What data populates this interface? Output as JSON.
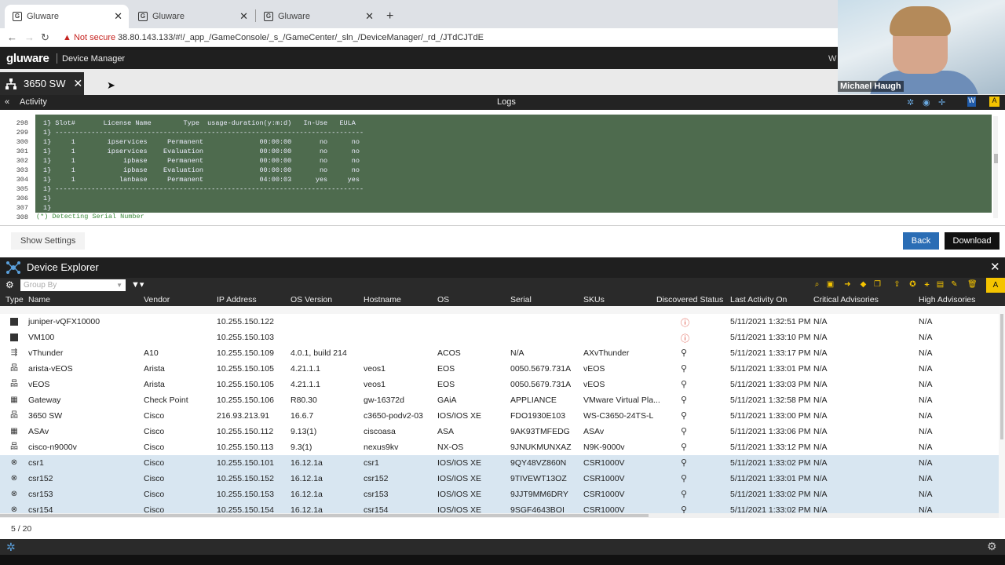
{
  "browser": {
    "tabs": [
      {
        "label": "Gluware",
        "active": true
      },
      {
        "label": "Gluware",
        "active": false
      },
      {
        "label": "Gluware",
        "active": false
      }
    ],
    "security_label": "Not secure",
    "url": "38.80.143.133/#!/_app_/GameConsole/_s_/GameCenter/_sln_/DeviceManager/_rd_/JTdCJTdE"
  },
  "app": {
    "logo": "gluware",
    "title": "Device Manager",
    "header_overflow": "W"
  },
  "device_tab": {
    "label": "3650 SW"
  },
  "activity_bar": {
    "left_label": "Activity",
    "center_label": "Logs"
  },
  "logs": {
    "line_numbers": [
      "298",
      "299",
      "300",
      "301",
      "302",
      "303",
      "304",
      "305",
      "306",
      "307",
      "308"
    ],
    "lines": [
      "1} Slot#       License Name        Type  usage-duration(y:m:d)   In-Use   EULA",
      "1} -----------------------------------------------------------------------------",
      "1}     1        ipservices     Permanent              00:00:00       no      no",
      "1}     1        ipservices    Evaluation              00:00:00       no      no",
      "1}     1            ipbase     Permanent              00:00:00       no      no",
      "1}     1            ipbase    Evaluation              00:00:00       no      no",
      "1}     1           lanbase     Permanent              04:00:03      yes     yes",
      "1} -----------------------------------------------------------------------------",
      "1}",
      "1}"
    ],
    "detecting": "(*) Detecting Serial Number"
  },
  "settings": {
    "show_settings": "Show Settings",
    "back": "Back",
    "download": "Download"
  },
  "explorer": {
    "title": "Device Explorer",
    "group_by_placeholder": "Group By",
    "columns": [
      "Type",
      "Name",
      "Vendor",
      "IP Address",
      "OS Version",
      "Hostname",
      "OS",
      "Serial",
      "SKUs",
      "Discovered Status",
      "Last Activity On",
      "Critical Advisories",
      "High Advisories"
    ],
    "rows": [
      {
        "type": "square",
        "name": "juniper-vQFX10000",
        "vendor": "",
        "ip": "10.255.150.122",
        "os_version": "",
        "hostname": "",
        "os": "",
        "serial": "",
        "skus": "",
        "status": "warn",
        "last": "5/11/2021 1:32:51 PM",
        "critical": "N/A",
        "high": "N/A",
        "selected": false
      },
      {
        "type": "square",
        "name": "VM100",
        "vendor": "",
        "ip": "10.255.150.103",
        "os_version": "",
        "hostname": "",
        "os": "",
        "serial": "",
        "skus": "",
        "status": "warn",
        "last": "5/11/2021 1:33:10 PM",
        "critical": "N/A",
        "high": "N/A",
        "selected": false
      },
      {
        "type": "loadbalancer",
        "name": "vThunder",
        "vendor": "A10",
        "ip": "10.255.150.109",
        "os_version": "4.0.1, build 214",
        "hostname": "",
        "os": "ACOS",
        "serial": "N/A",
        "skus": "AXvThunder",
        "status": "ok",
        "last": "5/11/2021 1:33:17 PM",
        "critical": "N/A",
        "high": "N/A",
        "selected": false
      },
      {
        "type": "switch",
        "name": "arista-vEOS",
        "vendor": "Arista",
        "ip": "10.255.150.105",
        "os_version": "4.21.1.1",
        "hostname": "veos1",
        "os": "EOS",
        "serial": "0050.5679.731A",
        "skus": "vEOS",
        "status": "ok",
        "last": "5/11/2021 1:33:01 PM",
        "critical": "N/A",
        "high": "N/A",
        "selected": false
      },
      {
        "type": "switch",
        "name": "vEOS",
        "vendor": "Arista",
        "ip": "10.255.150.105",
        "os_version": "4.21.1.1",
        "hostname": "veos1",
        "os": "EOS",
        "serial": "0050.5679.731A",
        "skus": "vEOS",
        "status": "ok",
        "last": "5/11/2021 1:33:03 PM",
        "critical": "N/A",
        "high": "N/A",
        "selected": false
      },
      {
        "type": "firewall",
        "name": "Gateway",
        "vendor": "Check Point",
        "ip": "10.255.150.106",
        "os_version": "R80.30",
        "hostname": "gw-16372d",
        "os": "GAiA",
        "serial": "APPLIANCE",
        "skus": "VMware Virtual Pla...",
        "status": "ok",
        "last": "5/11/2021 1:32:58 PM",
        "critical": "N/A",
        "high": "N/A",
        "selected": false
      },
      {
        "type": "switch",
        "name": "3650 SW",
        "vendor": "Cisco",
        "ip": "216.93.213.91",
        "os_version": "16.6.7",
        "hostname": "c3650-podv2-03",
        "os": "IOS/IOS XE",
        "serial": "FDO1930E103",
        "skus": "WS-C3650-24TS-L",
        "status": "ok",
        "last": "5/11/2021 1:33:00 PM",
        "critical": "N/A",
        "high": "N/A",
        "selected": false
      },
      {
        "type": "firewall",
        "name": "ASAv",
        "vendor": "Cisco",
        "ip": "10.255.150.112",
        "os_version": "9.13(1)",
        "hostname": "ciscoasa",
        "os": "ASA",
        "serial": "9AK93TMFEDG",
        "skus": "ASAv",
        "status": "ok",
        "last": "5/11/2021 1:33:06 PM",
        "critical": "N/A",
        "high": "N/A",
        "selected": false
      },
      {
        "type": "switch",
        "name": "cisco-n9000v",
        "vendor": "Cisco",
        "ip": "10.255.150.113",
        "os_version": "9.3(1)",
        "hostname": "nexus9kv",
        "os": "NX-OS",
        "serial": "9JNUKMUNXAZ",
        "skus": "N9K-9000v",
        "status": "ok",
        "last": "5/11/2021 1:33:12 PM",
        "critical": "N/A",
        "high": "N/A",
        "selected": false
      },
      {
        "type": "router",
        "name": "csr1",
        "vendor": "Cisco",
        "ip": "10.255.150.101",
        "os_version": "16.12.1a",
        "hostname": "csr1",
        "os": "IOS/IOS XE",
        "serial": "9QY48VZ860N",
        "skus": "CSR1000V",
        "status": "ok",
        "last": "5/11/2021 1:33:02 PM",
        "critical": "N/A",
        "high": "N/A",
        "selected": true
      },
      {
        "type": "router",
        "name": "csr152",
        "vendor": "Cisco",
        "ip": "10.255.150.152",
        "os_version": "16.12.1a",
        "hostname": "csr152",
        "os": "IOS/IOS XE",
        "serial": "9TIVEWT13OZ",
        "skus": "CSR1000V",
        "status": "ok",
        "last": "5/11/2021 1:33:01 PM",
        "critical": "N/A",
        "high": "N/A",
        "selected": true
      },
      {
        "type": "router",
        "name": "csr153",
        "vendor": "Cisco",
        "ip": "10.255.150.153",
        "os_version": "16.12.1a",
        "hostname": "csr153",
        "os": "IOS/IOS XE",
        "serial": "9JJT9MM6DRY",
        "skus": "CSR1000V",
        "status": "ok",
        "last": "5/11/2021 1:33:02 PM",
        "critical": "N/A",
        "high": "N/A",
        "selected": true
      },
      {
        "type": "router",
        "name": "csr154",
        "vendor": "Cisco",
        "ip": "10.255.150.154",
        "os_version": "16.12.1a",
        "hostname": "csr154",
        "os": "IOS/IOS XE",
        "serial": "9SGF4643BOI",
        "skus": "CSR1000V",
        "status": "ok",
        "last": "5/11/2021 1:33:02 PM",
        "critical": "N/A",
        "high": "N/A",
        "selected": true
      }
    ],
    "page_count": "5 / 20"
  },
  "webcam": {
    "name": "Michael Haugh"
  },
  "colors": {
    "log_green": "#4e6b4e",
    "back_blue": "#2a6db5",
    "selected_row": "#d8e6f1",
    "toolbar_yellow": "#f5c400",
    "warning_red": "#d83a2a"
  }
}
